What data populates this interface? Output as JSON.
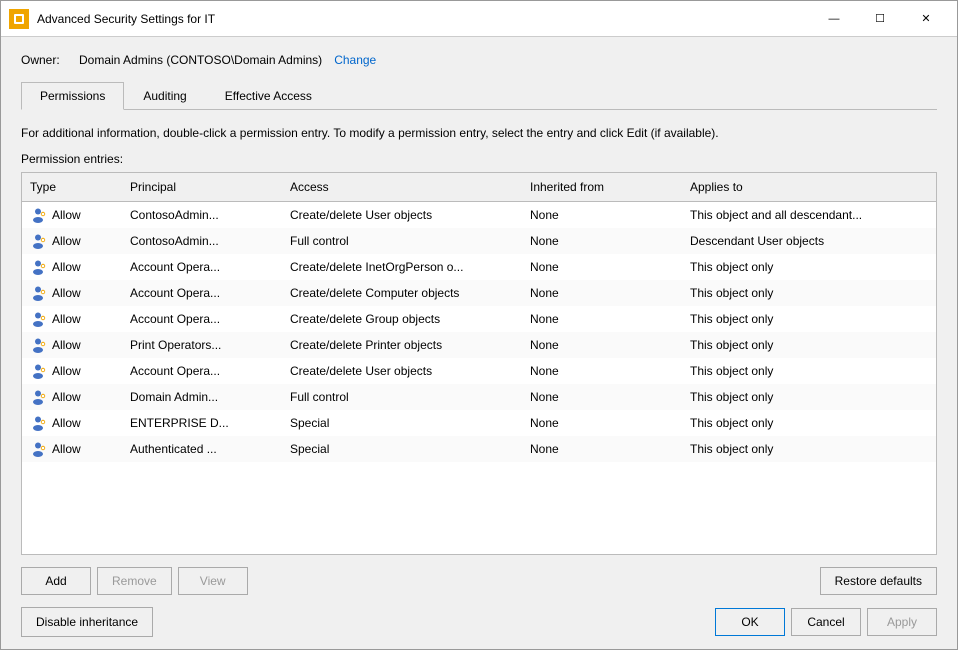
{
  "window": {
    "title": "Advanced Security Settings for IT",
    "icon": "🔒"
  },
  "title_bar": {
    "minimize_label": "—",
    "maximize_label": "☐",
    "close_label": "✕"
  },
  "owner": {
    "label": "Owner:",
    "value": "Domain Admins (CONTOSO\\Domain Admins)",
    "change_label": "Change"
  },
  "tabs": [
    {
      "id": "permissions",
      "label": "Permissions",
      "active": true
    },
    {
      "id": "auditing",
      "label": "Auditing",
      "active": false
    },
    {
      "id": "effective-access",
      "label": "Effective Access",
      "active": false
    }
  ],
  "description": "For additional information, double-click a permission entry. To modify a permission entry, select the entry and click Edit (if available).",
  "section_label": "Permission entries:",
  "table": {
    "columns": [
      {
        "id": "type",
        "label": "Type"
      },
      {
        "id": "principal",
        "label": "Principal"
      },
      {
        "id": "access",
        "label": "Access"
      },
      {
        "id": "inherited_from",
        "label": "Inherited from"
      },
      {
        "id": "applies_to",
        "label": "Applies to"
      }
    ],
    "rows": [
      {
        "type": "Allow",
        "principal": "ContosoAdmin...",
        "access": "Create/delete User objects",
        "inherited_from": "None",
        "applies_to": "This object and all descendant..."
      },
      {
        "type": "Allow",
        "principal": "ContosoAdmin...",
        "access": "Full control",
        "inherited_from": "None",
        "applies_to": "Descendant User objects"
      },
      {
        "type": "Allow",
        "principal": "Account Opera...",
        "access": "Create/delete InetOrgPerson o...",
        "inherited_from": "None",
        "applies_to": "This object only"
      },
      {
        "type": "Allow",
        "principal": "Account Opera...",
        "access": "Create/delete Computer objects",
        "inherited_from": "None",
        "applies_to": "This object only"
      },
      {
        "type": "Allow",
        "principal": "Account Opera...",
        "access": "Create/delete Group objects",
        "inherited_from": "None",
        "applies_to": "This object only"
      },
      {
        "type": "Allow",
        "principal": "Print Operators...",
        "access": "Create/delete Printer objects",
        "inherited_from": "None",
        "applies_to": "This object only"
      },
      {
        "type": "Allow",
        "principal": "Account Opera...",
        "access": "Create/delete User objects",
        "inherited_from": "None",
        "applies_to": "This object only"
      },
      {
        "type": "Allow",
        "principal": "Domain Admin...",
        "access": "Full control",
        "inherited_from": "None",
        "applies_to": "This object only"
      },
      {
        "type": "Allow",
        "principal": "ENTERPRISE D...",
        "access": "Special",
        "inherited_from": "None",
        "applies_to": "This object only"
      },
      {
        "type": "Allow",
        "principal": "Authenticated ...",
        "access": "Special",
        "inherited_from": "None",
        "applies_to": "This object only"
      }
    ]
  },
  "buttons": {
    "add": "Add",
    "remove": "Remove",
    "view": "View",
    "restore_defaults": "Restore defaults",
    "disable_inheritance": "Disable inheritance",
    "ok": "OK",
    "cancel": "Cancel",
    "apply": "Apply"
  }
}
